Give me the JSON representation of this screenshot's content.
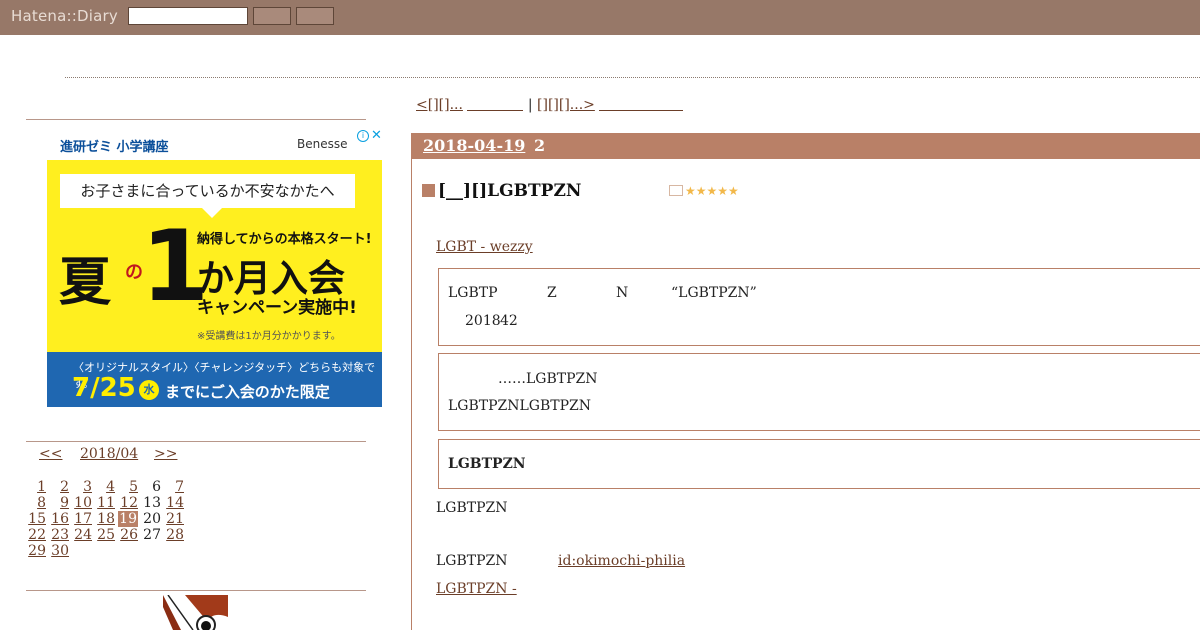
{
  "header": {
    "logo": "Hatena::Diary",
    "search_placeholder": "",
    "button1_label": "",
    "button2_label": ""
  },
  "ad": {
    "title": "進研ゼミ 小学講座",
    "brand": "Benesse",
    "info": "i",
    "close": "✕",
    "bubble": "お子さまに合っているか不安なかたへ",
    "big1": "夏",
    "no": "の",
    "one": "1",
    "line1": "納得してからの本格スタート!",
    "line2": "か月入会",
    "line3": "キャンペーン実施中!",
    "note": "※受講費は1か月分かかります。",
    "foot1": "〈オリジナルスタイル〉〈チャレンジタッチ〉どちらも対象です。",
    "foot_date": "7/25",
    "foot_day": "水",
    "foot2": "までにご入会のかた限定"
  },
  "calendar": {
    "prev": "<<",
    "month": "2018/04",
    "next": ">>",
    "days": [
      {
        "d": "1",
        "link": true
      },
      {
        "d": "2",
        "link": true
      },
      {
        "d": "3",
        "link": true
      },
      {
        "d": "4",
        "link": true
      },
      {
        "d": "5",
        "link": true
      },
      {
        "d": "6",
        "link": false
      },
      {
        "d": "7",
        "link": true
      },
      {
        "d": "8",
        "link": true
      },
      {
        "d": "9",
        "link": true
      },
      {
        "d": "10",
        "link": true
      },
      {
        "d": "11",
        "link": true
      },
      {
        "d": "12",
        "link": true
      },
      {
        "d": "13",
        "link": false
      },
      {
        "d": "14",
        "link": true
      },
      {
        "d": "15",
        "link": true
      },
      {
        "d": "16",
        "link": true
      },
      {
        "d": "17",
        "link": true
      },
      {
        "d": "18",
        "link": true
      },
      {
        "d": "19",
        "link": true,
        "today": true
      },
      {
        "d": "20",
        "link": false
      },
      {
        "d": "21",
        "link": true
      },
      {
        "d": "22",
        "link": true
      },
      {
        "d": "23",
        "link": true
      },
      {
        "d": "24",
        "link": true
      },
      {
        "d": "25",
        "link": true
      },
      {
        "d": "26",
        "link": true
      },
      {
        "d": "27",
        "link": false
      },
      {
        "d": "28",
        "link": true
      },
      {
        "d": "29",
        "link": true
      },
      {
        "d": "30",
        "link": true
      }
    ]
  },
  "pager": {
    "prev": "<[][]...",
    "sep": "|",
    "next": "[][][]...>"
  },
  "entry": {
    "date": "2018-04-19",
    "num": "2",
    "title": "[__][]LGBTPZN",
    "stars": "★★★★★",
    "source_link": "LGBT - wezzy",
    "quote1_a": "LGBTP",
    "quote1_b": "Z",
    "quote1_c": "N",
    "quote1_d": "“LGBTPZN”",
    "quote1_year": "2018",
    "quote1_rest": "42",
    "quote2_a": "……LGBTPZN",
    "quote2_b": "LGBTPZNLGBTPZN",
    "quote3": "LGBTPZN",
    "p1": "LGBTPZN",
    "p2": "LGBTPZN",
    "user_link": "id:okimochi-philia",
    "bottom_link": "LGBTPZN -"
  }
}
